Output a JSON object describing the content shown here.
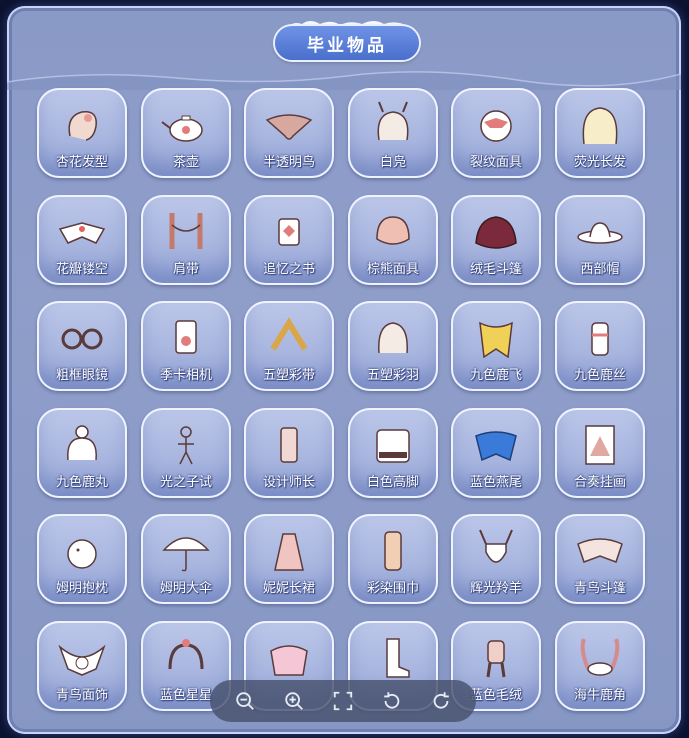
{
  "title": "毕业物品",
  "colors": {
    "panel": "#8a9ac6",
    "badge": "#4a6fcc",
    "tile": "#b3bfe4"
  },
  "items": [
    {
      "label": "杏花发型",
      "icon": "hairstyle-icon"
    },
    {
      "label": "茶壶",
      "icon": "teapot-icon"
    },
    {
      "label": "半透明鸟",
      "icon": "bird-icon"
    },
    {
      "label": "白凫",
      "icon": "duck-hair-icon"
    },
    {
      "label": "裂纹面具",
      "icon": "cracked-mask-icon"
    },
    {
      "label": "荧光长发",
      "icon": "long-hair-icon"
    },
    {
      "label": "花瓣镂空",
      "icon": "petal-cape-icon"
    },
    {
      "label": "肩带",
      "icon": "shoulder-strap-icon"
    },
    {
      "label": "追忆之书",
      "icon": "book-icon"
    },
    {
      "label": "棕熊面具",
      "icon": "bear-mask-icon"
    },
    {
      "label": "绒毛斗篷",
      "icon": "fluffy-cape-icon"
    },
    {
      "label": "西部帽",
      "icon": "cowboy-hat-icon"
    },
    {
      "label": "粗框眼镜",
      "icon": "glasses-icon"
    },
    {
      "label": "季卡相机",
      "icon": "camera-icon"
    },
    {
      "label": "五塑彩带",
      "icon": "ribbon-icon"
    },
    {
      "label": "五塑彩羽",
      "icon": "feather-hair-icon"
    },
    {
      "label": "九色鹿飞",
      "icon": "deer-cape-icon"
    },
    {
      "label": "九色鹿丝",
      "icon": "deer-outfit-icon"
    },
    {
      "label": "九色鹿丸",
      "icon": "bun-hair-icon"
    },
    {
      "label": "光之子试",
      "icon": "statue-icon"
    },
    {
      "label": "设计师长",
      "icon": "designer-outfit-icon"
    },
    {
      "label": "白色高脚",
      "icon": "piano-icon"
    },
    {
      "label": "蓝色燕尾",
      "icon": "blue-cape-icon"
    },
    {
      "label": "合奏挂画",
      "icon": "painting-icon"
    },
    {
      "label": "姆明抱枕",
      "icon": "moomin-icon"
    },
    {
      "label": "姆明大伞",
      "icon": "umbrella-icon"
    },
    {
      "label": "妮妮长裙",
      "icon": "dress-icon"
    },
    {
      "label": "彩染围巾",
      "icon": "scarf-icon"
    },
    {
      "label": "辉光羚羊",
      "icon": "antelope-mask-icon"
    },
    {
      "label": "青鸟斗篷",
      "icon": "bluebird-cape-icon"
    },
    {
      "label": "青鸟面饰",
      "icon": "bluebird-face-icon"
    },
    {
      "label": "蓝色星星",
      "icon": "star-headpiece-icon"
    },
    {
      "label": "",
      "icon": "pink-cape-icon"
    },
    {
      "label": "",
      "icon": "boots-icon"
    },
    {
      "label": "蓝色毛绒",
      "icon": "plush-outfit-icon"
    },
    {
      "label": "海牛鹿角",
      "icon": "antler-icon"
    }
  ],
  "toolbar": {
    "buttons": [
      {
        "name": "zoom-out",
        "icon": "zoom-out-icon"
      },
      {
        "name": "zoom-in",
        "icon": "zoom-in-icon"
      },
      {
        "name": "fullscreen",
        "icon": "fullscreen-icon"
      },
      {
        "name": "rotate-left",
        "icon": "rotate-left-icon"
      },
      {
        "name": "rotate-right",
        "icon": "rotate-right-icon"
      }
    ]
  }
}
